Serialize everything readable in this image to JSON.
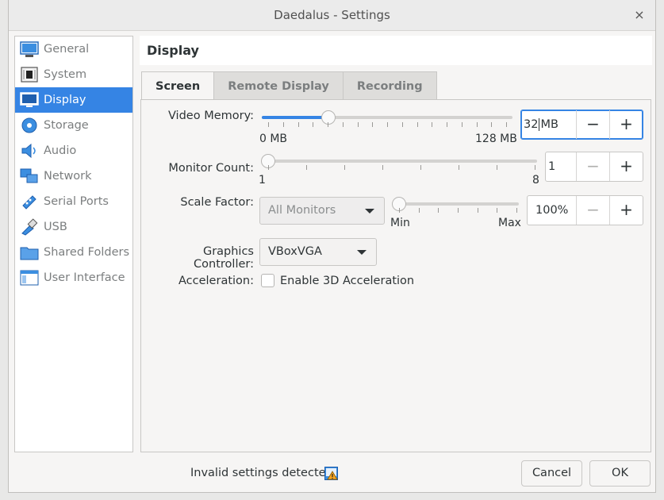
{
  "window": {
    "title": "Daedalus - Settings",
    "close_glyph": "×"
  },
  "sidebar": {
    "items": [
      {
        "label": "General",
        "icon": "general-icon"
      },
      {
        "label": "System",
        "icon": "system-icon"
      },
      {
        "label": "Display",
        "icon": "display-icon",
        "active": true
      },
      {
        "label": "Storage",
        "icon": "storage-icon"
      },
      {
        "label": "Audio",
        "icon": "audio-icon"
      },
      {
        "label": "Network",
        "icon": "network-icon"
      },
      {
        "label": "Serial Ports",
        "icon": "serial-ports-icon"
      },
      {
        "label": "USB",
        "icon": "usb-icon"
      },
      {
        "label": "Shared Folders",
        "icon": "shared-folders-icon"
      },
      {
        "label": "User Interface",
        "icon": "user-interface-icon"
      }
    ]
  },
  "header": {
    "title": "Display"
  },
  "tabs": [
    "Screen",
    "Remote Display",
    "Recording"
  ],
  "screen": {
    "video_memory": {
      "label": "Video Memory:",
      "min_label": "0 MB",
      "max_label": "128 MB",
      "value": "32",
      "unit": "MB",
      "level": 0.25
    },
    "monitor_count": {
      "label": "Monitor Count:",
      "min_label": "1",
      "max_label": "8",
      "value": "1",
      "level": 0.0
    },
    "scale_factor": {
      "label": "Scale Factor:",
      "combo": "All Monitors",
      "min_label": "Min",
      "max_label": "Max",
      "value": "100%",
      "level": 0.0
    },
    "graphics_controller": {
      "label": "Graphics Controller:",
      "value": "VBoxVGA"
    },
    "acceleration": {
      "label": "Acceleration:",
      "checkbox_label": "Enable 3D Acceleration",
      "checked": false
    }
  },
  "spin_glyphs": {
    "minus": "−",
    "plus": "+"
  },
  "footer": {
    "status": "Invalid settings detected",
    "status_icon": "warning-icon",
    "cancel": "Cancel",
    "ok": "OK"
  },
  "colors": {
    "accent": "#3584e4"
  }
}
